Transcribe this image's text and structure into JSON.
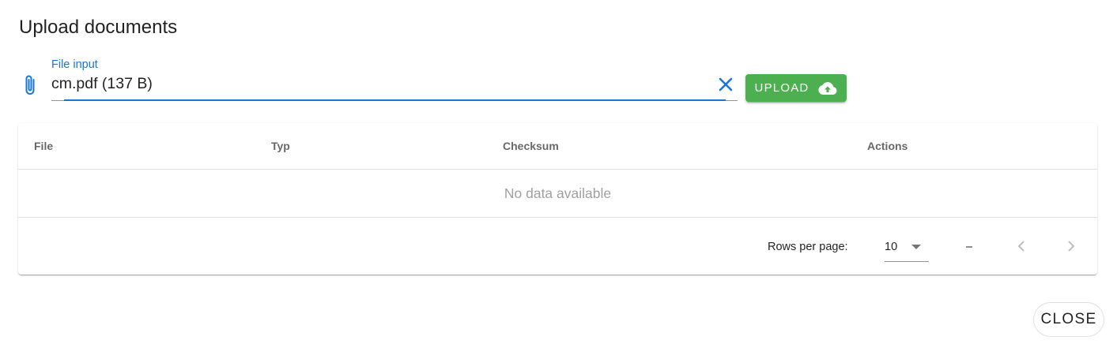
{
  "dialog": {
    "title": "Upload documents"
  },
  "file_input": {
    "label": "File input",
    "value": "cm.pdf (137 B)",
    "icon": "paperclip-icon",
    "clear_icon": "close-icon"
  },
  "upload_button": {
    "label": "UPLOAD",
    "icon": "cloud-upload-icon",
    "color": "#4caf50"
  },
  "table": {
    "headers": [
      "File",
      "Typ",
      "Checksum",
      "Actions"
    ],
    "empty_text": "No data available",
    "footer": {
      "rows_per_page_label": "Rows per page:",
      "rows_per_page_value": "10",
      "page_info": "–"
    }
  },
  "close_button": {
    "label": "CLOSE"
  },
  "colors": {
    "accent": "#1976d2",
    "success": "#4caf50"
  }
}
